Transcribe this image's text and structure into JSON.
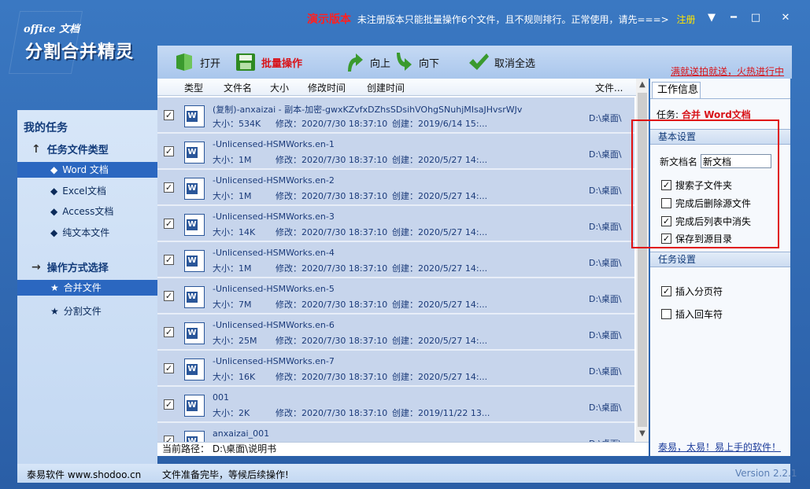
{
  "logo": {
    "small": "office 文档",
    "big": "分割合并精灵"
  },
  "titlebar": {
    "demo": "演示版本",
    "notice": "未注册版本只能批量操作6个文件，且不规则排行。正常使用，请先===>",
    "register": "注册",
    "controls": [
      "▼",
      "━",
      "□",
      "✕"
    ]
  },
  "toolbar": {
    "open": "打开",
    "batch": "批量操作",
    "up": "向上",
    "down": "向下",
    "cancel_all": "取消全选"
  },
  "promo": "满就送拍就送，火热进行中",
  "sidebar": {
    "title": "我的任务",
    "group1": "任务文件类型",
    "types": [
      "Word 文档",
      "Excel文档",
      "Access文档",
      "纯文本文件"
    ],
    "group2": "操作方式选择",
    "modes": [
      "合并文件",
      "分割文件"
    ]
  },
  "list": {
    "columns": [
      "类型",
      "文件名",
      "大小",
      "修改时间",
      "创建时间",
      "文件..."
    ],
    "rows": [
      {
        "name": "(复制)-anxaizai - 副本-加密-gwxKZvfxDZhsSDsihVOhgSNuhjMIsaJHvsrWJv",
        "size": "大小：534K",
        "modified": "修改：2020/7/30 18:37:10",
        "created": "创建：2019/6/14 15:...",
        "loc": "D:\\桌面\\"
      },
      {
        "name": "-Unlicensed-HSMWorks.en-1",
        "size": "大小：1M",
        "modified": "修改：2020/7/30 18:37:10",
        "created": "创建：2020/5/27 14:...",
        "loc": "D:\\桌面\\"
      },
      {
        "name": "-Unlicensed-HSMWorks.en-2",
        "size": "大小：1M",
        "modified": "修改：2020/7/30 18:37:10",
        "created": "创建：2020/5/27 14:...",
        "loc": "D:\\桌面\\"
      },
      {
        "name": "-Unlicensed-HSMWorks.en-3",
        "size": "大小：14K",
        "modified": "修改：2020/7/30 18:37:10",
        "created": "创建：2020/5/27 14:...",
        "loc": "D:\\桌面\\"
      },
      {
        "name": "-Unlicensed-HSMWorks.en-4",
        "size": "大小：1M",
        "modified": "修改：2020/7/30 18:37:10",
        "created": "创建：2020/5/27 14:...",
        "loc": "D:\\桌面\\"
      },
      {
        "name": "-Unlicensed-HSMWorks.en-5",
        "size": "大小：7M",
        "modified": "修改：2020/7/30 18:37:10",
        "created": "创建：2020/5/27 14:...",
        "loc": "D:\\桌面\\"
      },
      {
        "name": "-Unlicensed-HSMWorks.en-6",
        "size": "大小：25M",
        "modified": "修改：2020/7/30 18:37:10",
        "created": "创建：2020/5/27 14:...",
        "loc": "D:\\桌面\\"
      },
      {
        "name": "-Unlicensed-HSMWorks.en-7",
        "size": "大小：16K",
        "modified": "修改：2020/7/30 18:37:10",
        "created": "创建：2020/5/27 14:...",
        "loc": "D:\\桌面\\"
      },
      {
        "name": "001",
        "size": "大小：2K",
        "modified": "修改：2020/7/30 18:37:10",
        "created": "创建：2019/11/22 13...",
        "loc": "D:\\桌面\\"
      },
      {
        "name": "anxaizai_001",
        "size": "",
        "modified": "",
        "created": "",
        "loc": "D:\\桌面\\"
      }
    ]
  },
  "path": "当前路径：  D:\\桌面\\说明书",
  "right": {
    "tab": "工作信息",
    "task_label": "任务:",
    "task_value": "合并 Word文档",
    "basic": "基本设置",
    "newname_label": "新文档名",
    "newname_value": "新文档",
    "options": [
      "搜索子文件夹",
      "完成后删除源文件",
      "完成后列表中消失",
      "保存到源目录"
    ],
    "task_settings": "任务设置",
    "task_options": [
      "插入分页符",
      "插入回车符"
    ],
    "link": "泰易，太易！易上手的软件！"
  },
  "status": {
    "brand": "泰易软件 www.shodoo.cn",
    "msg": "文件准备完毕，等候后续操作!",
    "version": "Version 2.2.1"
  },
  "colors": {
    "accent": "#2b67c0",
    "red": "#d8141a",
    "yellow": "#ffe400"
  }
}
